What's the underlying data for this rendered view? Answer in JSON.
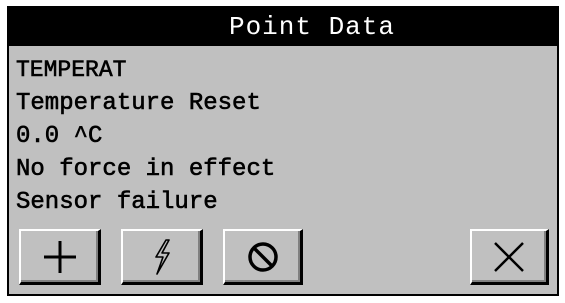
{
  "window": {
    "title": "Point Data"
  },
  "point": {
    "lines": [
      "TEMPERAT",
      "Temperature Reset",
      "0.0 ^C",
      "No force in effect",
      "Sensor failure"
    ]
  },
  "toolbar": {
    "buttons": [
      {
        "name": "add",
        "icon": "plus-icon"
      },
      {
        "name": "force",
        "icon": "lightning-icon"
      },
      {
        "name": "disable",
        "icon": "prohibited-icon"
      },
      {
        "name": "close",
        "icon": "close-icon"
      }
    ]
  }
}
